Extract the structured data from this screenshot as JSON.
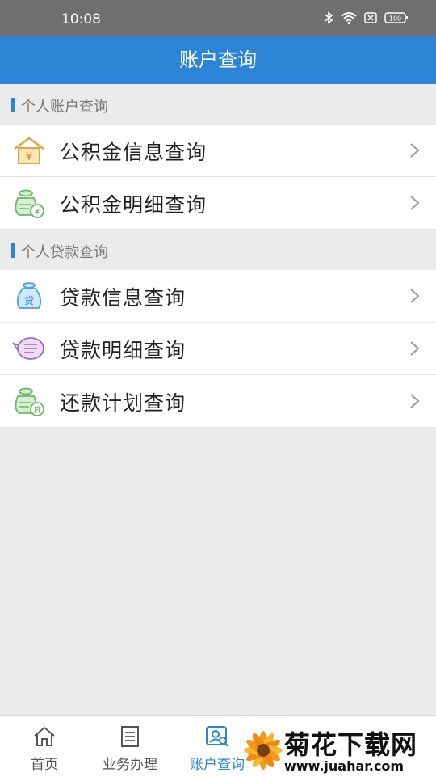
{
  "status": {
    "time": "10:08",
    "battery": "100"
  },
  "header": {
    "title": "账户查询"
  },
  "sections": [
    {
      "title": "个人账户查询",
      "items": [
        {
          "label": "公积金信息查询",
          "icon": "house-yen-icon"
        },
        {
          "label": "公积金明细查询",
          "icon": "money-bag-yen-icon"
        }
      ]
    },
    {
      "title": "个人贷款查询",
      "items": [
        {
          "label": "贷款信息查询",
          "icon": "loan-bag-icon"
        },
        {
          "label": "贷款明细查询",
          "icon": "list-bubble-icon"
        },
        {
          "label": "还款计划查询",
          "icon": "repay-bag-icon"
        }
      ]
    }
  ],
  "tabs": [
    {
      "label": "首页",
      "icon": "home-icon"
    },
    {
      "label": "业务办理",
      "icon": "document-icon"
    },
    {
      "label": "账户查询",
      "icon": "person-search-icon",
      "active": true
    }
  ],
  "watermark": {
    "text": "菊花下载网",
    "url": "www.juahar.com"
  },
  "colors": {
    "accent": "#2b84d6",
    "statusbar": "#6f6f6f",
    "background": "#ebebeb"
  }
}
